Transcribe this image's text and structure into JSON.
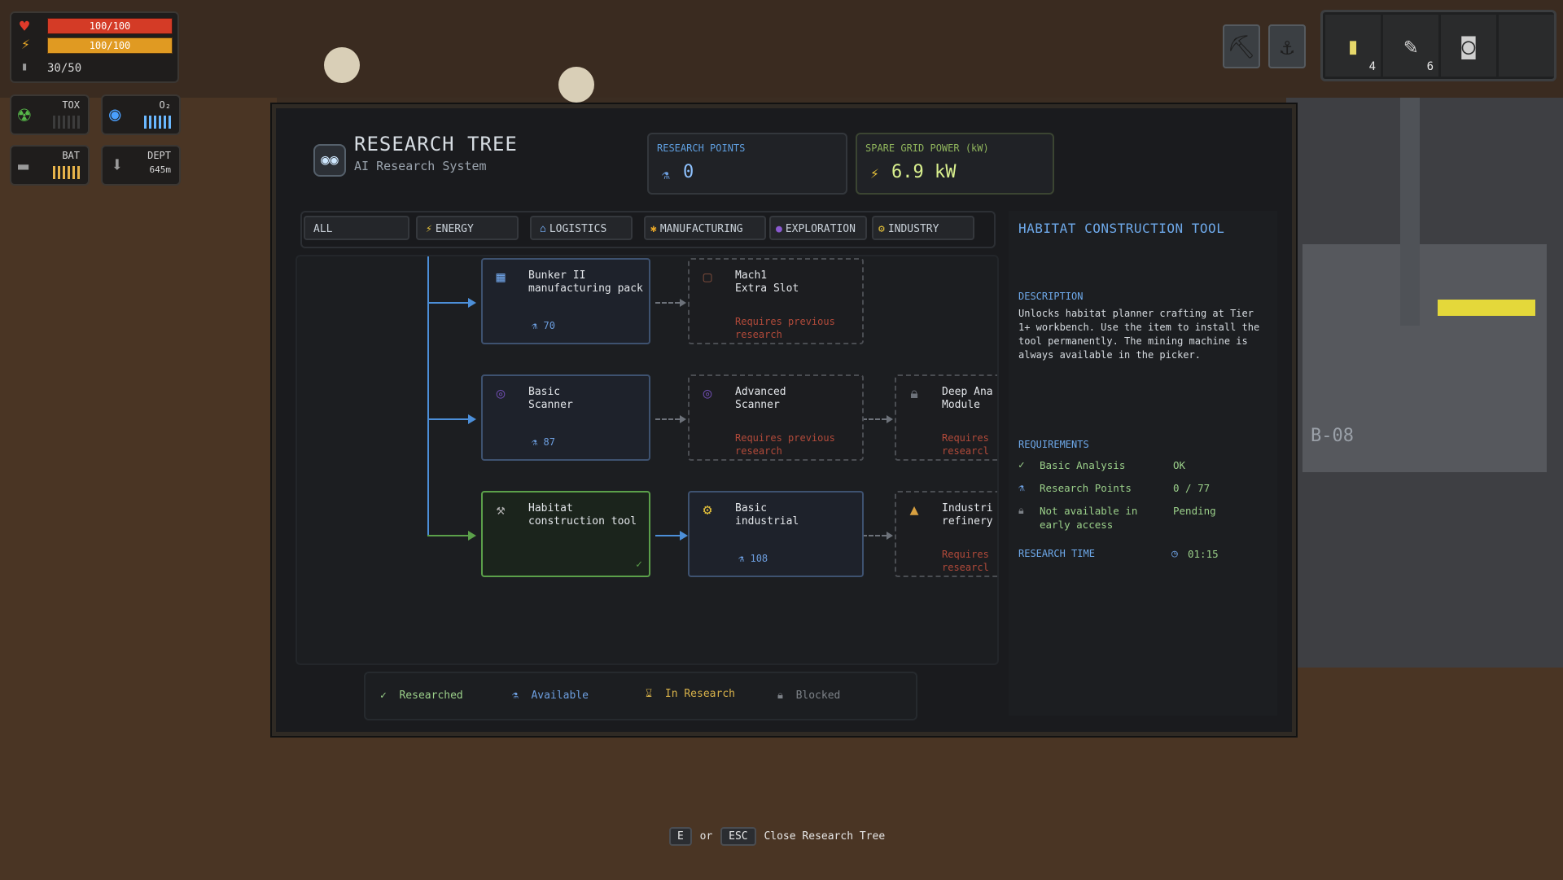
{
  "hud": {
    "health": "100/100",
    "energy": "100/100",
    "ammo": "30/50",
    "tox_label": "TOX",
    "o2_label": "O₂",
    "bat_label": "BAT",
    "depth_label": "DEPT",
    "depth_value": "645m"
  },
  "hotbar": [
    {
      "icon": "fuel-canister-icon",
      "count": "4"
    },
    {
      "icon": "syringe-icon",
      "count": "6"
    },
    {
      "icon": "bucket-icon",
      "count": ""
    },
    {
      "icon": "empty-slot",
      "count": ""
    }
  ],
  "world": {
    "sign": "B-08"
  },
  "research": {
    "title": "RESEARCH TREE",
    "subtitle": "AI Research System",
    "points_label": "RESEARCH POINTS",
    "points_value": "0",
    "power_label": "SPARE GRID POWER (kW)",
    "power_value": "6.9 kW",
    "tabs": [
      "ALL",
      "ENERGY",
      "LOGISTICS",
      "MANUFACTURING",
      "EXPLORATION",
      "INDUSTRY"
    ],
    "nodes": {
      "bunker": {
        "name": "Bunker II\nmanufacturing pack",
        "cost": "70"
      },
      "mach1": {
        "name": "Mach1\nExtra Slot",
        "req": "Requires previous research"
      },
      "basic_scanner": {
        "name": "Basic\nScanner",
        "cost": "87"
      },
      "adv_scanner": {
        "name": "Advanced\nScanner",
        "req": "Requires previous research"
      },
      "deep_analysis": {
        "name": "Deep Ana\nModule",
        "req": "Requires\nresearcl"
      },
      "habitat": {
        "name": "Habitat\nconstruction tool"
      },
      "basic_industrial": {
        "name": "Basic\nindustrial",
        "cost": "108"
      },
      "industrial_refinery": {
        "name": "Industri\nrefinery",
        "req": "Requires\nresearcl"
      }
    },
    "legend": {
      "researched": "Researched",
      "available": "Available",
      "in_research": "In Research",
      "blocked": "Blocked"
    },
    "detail": {
      "title": "HABITAT CONSTRUCTION TOOL",
      "description_label": "DESCRIPTION",
      "description": "Unlocks habitat planner crafting at Tier 1+ workbench. Use the item to install the tool permanently. The mining machine is always available in the picker.",
      "requirements_label": "REQUIREMENTS",
      "requirements": [
        {
          "name": "Basic Analysis",
          "status": "OK"
        },
        {
          "name": "Research Points",
          "status": "0 / 77"
        },
        {
          "name": "Not available in early access",
          "status": "Pending"
        }
      ],
      "time_label": "RESEARCH TIME",
      "time_value": "01:15"
    }
  },
  "footer": {
    "key1": "E",
    "or": "or",
    "key2": "ESC",
    "action": "Close Research Tree"
  }
}
